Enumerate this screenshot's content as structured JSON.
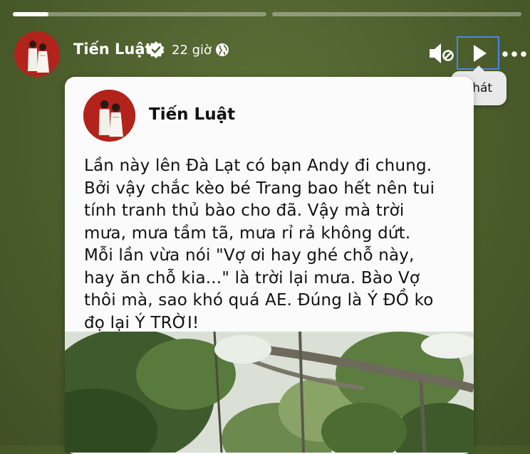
{
  "story": {
    "progress": [
      {
        "value": 0.14
      },
      {
        "value": 0
      }
    ]
  },
  "header": {
    "author_name": "Tiến Luật",
    "time": "22 giờ",
    "audience_icon": "globe-icon",
    "verified_icon": "verified-badge-icon",
    "mute_icon": "speaker-muted-icon",
    "play_icon": "play-icon",
    "more_icon": "more-horizontal-icon",
    "tooltip": "Phát"
  },
  "card": {
    "author_name": "Tiến Luật",
    "lines": [
      "Lần này lên Đà Lạt có bạn Andy đi chung.",
      "Bởi vậy chắc kèo bé Trang bao hết nên tui",
      "tính tranh thủ bào cho đã. Vậy mà trời",
      "mưa, mưa tầm tã, mưa rỉ rả không dứt.",
      "Mỗi lần vừa nói \"Vợ ơi hay ghé chỗ này,",
      "hay ăn chỗ kia...\" là trời lại mưa. Bào Vợ",
      "thôi mà, sao khó quá AE. Đúng là Ý ĐỒ ko",
      "đọ lại Ý TRỜI!"
    ]
  },
  "colors": {
    "background": "#4f612e",
    "avatar_red": "#b2231c",
    "focus_outline": "#4a85f0"
  }
}
